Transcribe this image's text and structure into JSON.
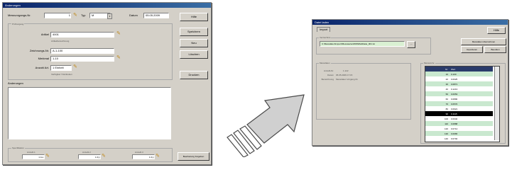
{
  "left_window": {
    "title": "Änderungen",
    "header": {
      "nr_label": "Messvorgangs-Nr.",
      "nr_value": "1",
      "typ_label": "Typ",
      "typ_value": "M",
      "datum_label": "Datum",
      "datum_value": "05.05.2009"
    },
    "group_title": "Prüfvorgang",
    "fields": [
      {
        "label": "Artikel",
        "value": "4001",
        "hint": "Artikelbezeichnung"
      },
      {
        "label": "Zeichnungs-Nr.",
        "value": "A-1-100",
        "hint": ""
      },
      {
        "label": "Merkmal",
        "value": "1-10",
        "hint": ""
      },
      {
        "label": "Anzahl Art.",
        "value": "1 Einheit",
        "hint": "Verfügbar: 5 Einheiten"
      }
    ],
    "changes_label": "Änderungen",
    "bottom_group_title": "Spezifikation",
    "bottom_fields": [
      {
        "label": "Anzahl 1",
        "value": "1.0+/-"
      },
      {
        "label": "Anzahl 2",
        "value": "1.0(-)"
      },
      {
        "label": "Anzahl 3",
        "value": "1.0(-)"
      }
    ],
    "buttons": [
      "Hilfe",
      "Speichern",
      "Neu",
      "Löschen",
      "Drucken"
    ],
    "footer_button": "Bearbeitung freigeben"
  },
  "right_window": {
    "title": "Datei laden",
    "tab": "Import",
    "top_button": "Hilfe",
    "path_group_title": "Verzeichnis",
    "path_value": "C:\\Messdaten\\Import\\Messwerte\\2009\\Mai\\Datei_001.txt",
    "browse_label": "...",
    "buttons": [
      "Messdaten übernehmen",
      "Importieren",
      "Beenden"
    ],
    "info_group_title": "Messdaten",
    "info_rows": [
      {
        "label": "Anzahl-Nr.",
        "value": "1.122"
      },
      {
        "label": "Datum",
        "value": "05.05.2009 17:15"
      },
      {
        "label": "Bezeichnung",
        "value": "Messdaten Vorgang 01"
      }
    ],
    "list_group_title": "Messwerte",
    "list_headers": [
      "Nr.",
      "Wert"
    ],
    "list_rows": [
      [
        "10",
        "0.100"
      ],
      [
        "20",
        "0.0625"
      ],
      [
        "30",
        "0.0871"
      ],
      [
        "40",
        "0.1213"
      ],
      [
        "50",
        "0.0653"
      ],
      [
        "60",
        "0.0890"
      ],
      [
        "70",
        "0.0570"
      ],
      [
        "80",
        "0.0921"
      ],
      [
        "90",
        "0.1115"
      ],
      [
        "100",
        "0.0640"
      ],
      [
        "110",
        "0.0888"
      ],
      [
        "120",
        "0.0714"
      ],
      [
        "130",
        "0.0965"
      ],
      [
        "140",
        "0.0702"
      ]
    ],
    "selected_row": 8
  },
  "colors": {
    "window": "#d4d0c8",
    "title_start": "#0a246a",
    "title_end": "#3a6ea5",
    "selection": "#000000",
    "list_alt": "#c9e8cf",
    "path_field": "#d9f0d2",
    "arrow": "#d0d0d0"
  }
}
